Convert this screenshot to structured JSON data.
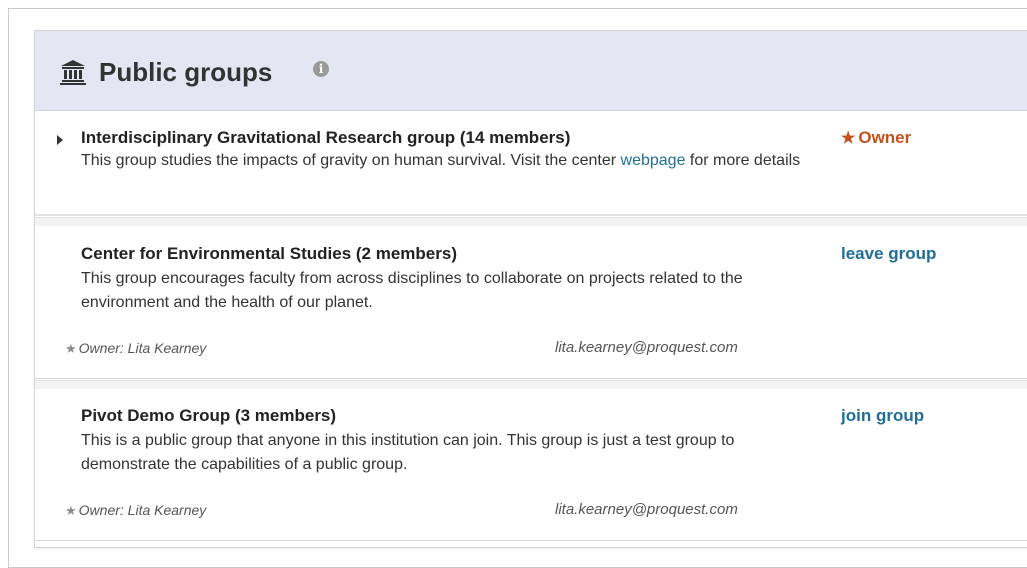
{
  "section": {
    "title": "Public groups",
    "icon": "institution-icon",
    "info_icon": "info-icon",
    "info_glyph": "i"
  },
  "groups": [
    {
      "title": "Interdisciplinary Gravitational Research group  (14 members)",
      "description_before_link": "This group studies the impacts of gravity on human survival.  Visit the center ",
      "description_link": "webpage",
      "description_after_link": " for more details",
      "action": "Owner",
      "action_icon": "star-icon",
      "expanded_indicator": "caret-right-icon"
    },
    {
      "title": "Center for Environmental Studies  (2 members)",
      "description": "This group encourages faculty from across disciplines to collaborate on projects related to the environment and the health of our planet.",
      "action": "leave group",
      "owner_label": "Owner: Lita Kearney",
      "owner_email": "lita.kearney@proquest.com"
    },
    {
      "title": "Pivot Demo Group  (3 members)",
      "description": "This is a public group that anyone in this institution can join.  This group is just a test group to demonstrate the capabilities of a public group.",
      "action": "join group",
      "owner_label": "Owner: Lita Kearney",
      "owner_email": "lita.kearney@proquest.com"
    }
  ],
  "colors": {
    "header_bg": "#e4e7f3",
    "owner_status": "#c1521c",
    "link": "#1f6e97"
  }
}
